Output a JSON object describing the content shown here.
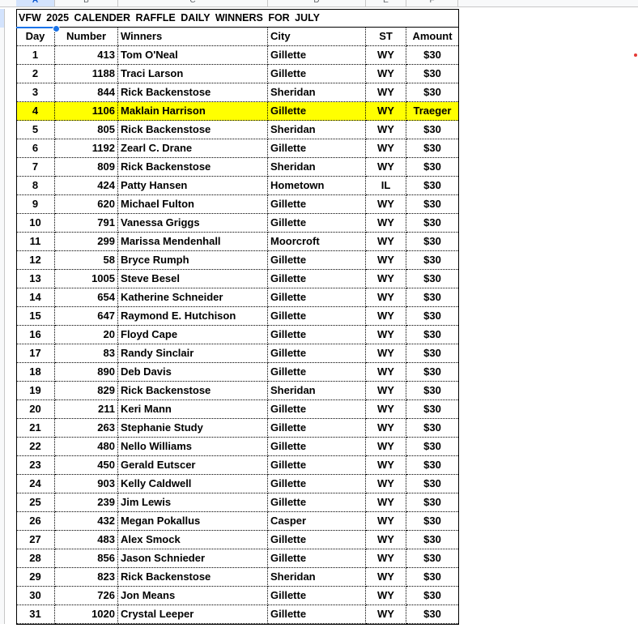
{
  "column_letters": [
    "A",
    "B",
    "C",
    "D",
    "E",
    "F"
  ],
  "title": "VFW  2025  CALENDER  RAFFLE  DAILY  WINNERS  FOR  JULY",
  "headers": {
    "day": "Day",
    "number": "Number",
    "winners": "Winners",
    "city": "City",
    "st": "ST",
    "amount": "Amount"
  },
  "highlight_color": "#ffff00",
  "rows": [
    {
      "day": "1",
      "number": "413",
      "winner": "Tom O'Neal",
      "city": "Gillette",
      "st": "WY",
      "amount": "$30"
    },
    {
      "day": "2",
      "number": "1188",
      "winner": "Traci Larson",
      "city": "Gillette",
      "st": "WY",
      "amount": "$30"
    },
    {
      "day": "3",
      "number": "844",
      "winner": "Rick Backenstose",
      "city": "Sheridan",
      "st": "WY",
      "amount": "$30"
    },
    {
      "day": "4",
      "number": "1106",
      "winner": "Maklain Harrison",
      "city": "Gillette",
      "st": "WY",
      "amount": "Traeger",
      "highlighted": true
    },
    {
      "day": "5",
      "number": "805",
      "winner": "Rick Backenstose",
      "city": "Sheridan",
      "st": "WY",
      "amount": "$30"
    },
    {
      "day": "6",
      "number": "1192",
      "winner": "Zearl C. Drane",
      "city": "Gillette",
      "st": "WY",
      "amount": "$30"
    },
    {
      "day": "7",
      "number": "809",
      "winner": "Rick Backenstose",
      "city": "Sheridan",
      "st": "WY",
      "amount": "$30"
    },
    {
      "day": "8",
      "number": "424",
      "winner": "Patty Hansen",
      "city": "Hometown",
      "st": "IL",
      "amount": "$30"
    },
    {
      "day": "9",
      "number": "620",
      "winner": "Michael Fulton",
      "city": "Gillette",
      "st": "WY",
      "amount": "$30"
    },
    {
      "day": "10",
      "number": "791",
      "winner": "Vanessa Griggs",
      "city": "Gillette",
      "st": "WY",
      "amount": "$30"
    },
    {
      "day": "11",
      "number": "299",
      "winner": "Marissa Mendenhall",
      "city": "Moorcroft",
      "st": "WY",
      "amount": "$30"
    },
    {
      "day": "12",
      "number": "58",
      "winner": "Bryce Rumph",
      "city": "Gillette",
      "st": "WY",
      "amount": "$30"
    },
    {
      "day": "13",
      "number": "1005",
      "winner": "Steve Besel",
      "city": "Gillette",
      "st": "WY",
      "amount": "$30"
    },
    {
      "day": "14",
      "number": "654",
      "winner": "Katherine Schneider",
      "city": "Gillette",
      "st": "WY",
      "amount": "$30"
    },
    {
      "day": "15",
      "number": "647",
      "winner": "Raymond E. Hutchison",
      "city": "Gillette",
      "st": "WY",
      "amount": "$30"
    },
    {
      "day": "16",
      "number": "20",
      "winner": "Floyd Cape",
      "city": "Gillette",
      "st": "WY",
      "amount": "$30"
    },
    {
      "day": "17",
      "number": "83",
      "winner": "Randy Sinclair",
      "city": "Gillette",
      "st": "WY",
      "amount": "$30"
    },
    {
      "day": "18",
      "number": "890",
      "winner": "Deb Davis",
      "city": "Gillette",
      "st": "WY",
      "amount": "$30"
    },
    {
      "day": "19",
      "number": "829",
      "winner": "Rick Backenstose",
      "city": "Sheridan",
      "st": "WY",
      "amount": "$30"
    },
    {
      "day": "20",
      "number": "211",
      "winner": "Keri Mann",
      "city": "Gillette",
      "st": "WY",
      "amount": "$30"
    },
    {
      "day": "21",
      "number": "263",
      "winner": "Stephanie Study",
      "city": "Gillette",
      "st": "WY",
      "amount": "$30"
    },
    {
      "day": "22",
      "number": "480",
      "winner": "Nello Williams",
      "city": "Gillette",
      "st": "WY",
      "amount": "$30"
    },
    {
      "day": "23",
      "number": "450",
      "winner": "Gerald Eutscer",
      "city": "Gillette",
      "st": "WY",
      "amount": "$30"
    },
    {
      "day": "24",
      "number": "903",
      "winner": "Kelly Caldwell",
      "city": "Gillette",
      "st": "WY",
      "amount": "$30"
    },
    {
      "day": "25",
      "number": "239",
      "winner": "Jim Lewis",
      "city": "Gillette",
      "st": "WY",
      "amount": "$30"
    },
    {
      "day": "26",
      "number": "432",
      "winner": "Megan Pokallus",
      "city": "Casper",
      "st": "WY",
      "amount": "$30"
    },
    {
      "day": "27",
      "number": "483",
      "winner": "Alex Smock",
      "city": "Gillette",
      "st": "WY",
      "amount": "$30"
    },
    {
      "day": "28",
      "number": "856",
      "winner": "Jason Schnieder",
      "city": "Gillette",
      "st": "WY",
      "amount": "$30"
    },
    {
      "day": "29",
      "number": "823",
      "winner": "Rick Backenstose",
      "city": "Sheridan",
      "st": "WY",
      "amount": "$30"
    },
    {
      "day": "30",
      "number": "726",
      "winner": "Jon Means",
      "city": "Gillette",
      "st": "WY",
      "amount": "$30"
    },
    {
      "day": "31",
      "number": "1020",
      "winner": "Crystal Leeper",
      "city": "Gillette",
      "st": "WY",
      "amount": "$30"
    }
  ]
}
